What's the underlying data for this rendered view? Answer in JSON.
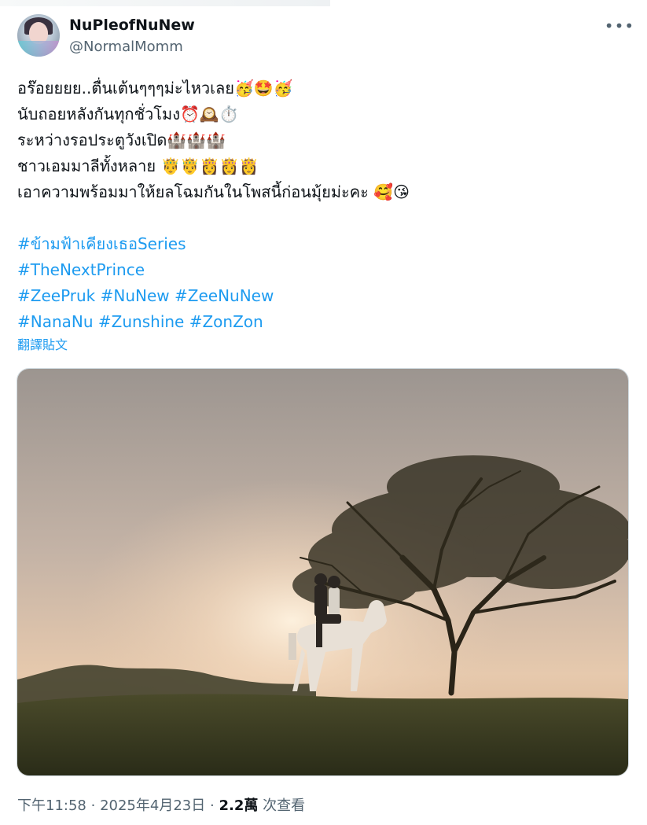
{
  "author": {
    "name": "NuPleofNuNew",
    "handle": "@NormalMomm"
  },
  "menu_icon": "more-horizontal-icon",
  "tweet": {
    "lines": [
      {
        "text": "อร๊อยยยย..ตื่นเต้นๆๆๆม่ะไหวเลย",
        "emoji": "🥳🤩🥳"
      },
      {
        "text": "นับถอยหลังกันทุกชั่วโมง",
        "emoji": "⏰🕰️⏱️"
      },
      {
        "text": "ระหว่างรอประตูวังเปิด",
        "emoji": "🏰🏰🏰"
      },
      {
        "text": "ชาวเอมมาลีทั้งหลาย ",
        "emoji": "🤴🤴👸👸👸"
      },
      {
        "text": "เอาความพร้อมมาให้ยลโฉมกันในโพสนี้ก่อนมุ้ยม่ะคะ ",
        "emoji": "🥰😘"
      }
    ],
    "hashtag_lines": [
      [
        "#ข้ามฟ้าเคียงเธอSeries"
      ],
      [
        "#TheNextPrince"
      ],
      [
        "#ZeePruk",
        "#NuNew",
        "#ZeeNuNew"
      ],
      [
        "#NanaNu",
        "#Zunshine",
        "#ZonZon"
      ]
    ],
    "translate_label": "翻譯貼文"
  },
  "meta": {
    "time": "下午11:58",
    "separator": "·",
    "date": "2025年4月23日",
    "views_count": "2.2萬",
    "views_label": "次查看"
  },
  "colors": {
    "link": "#1d9bf0",
    "text": "#0f1419",
    "secondary": "#536471"
  }
}
